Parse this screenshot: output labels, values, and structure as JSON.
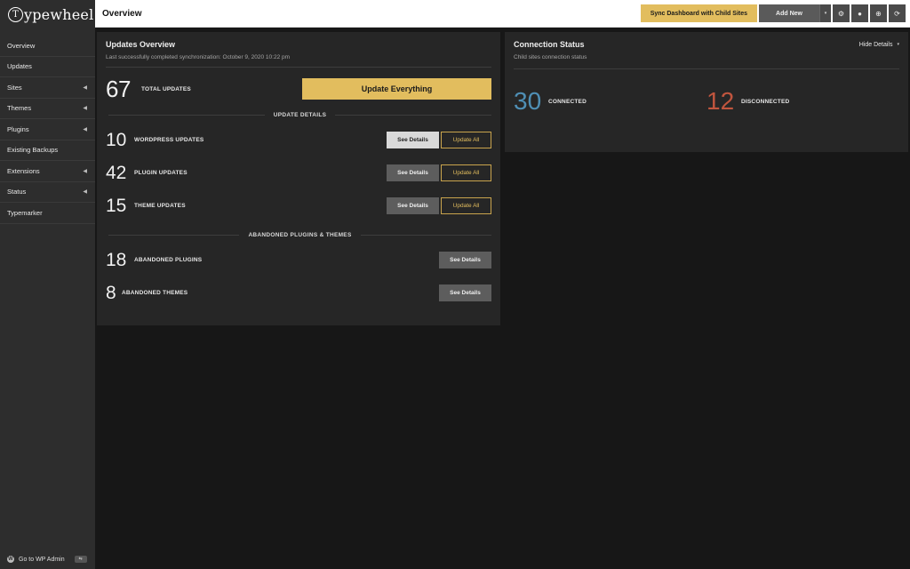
{
  "app": {
    "logo_text": "ypewheel",
    "logo_mark": "T"
  },
  "header": {
    "title": "Overview"
  },
  "toolbar": {
    "sync_label": "Sync Dashboard with Child Sites",
    "add_label": "Add New",
    "caret": "▾",
    "icons": [
      "gear-icon",
      "lightbulb-icon",
      "globe-icon",
      "refresh-icon"
    ]
  },
  "sidebar": {
    "items": [
      {
        "label": "Overview",
        "has_submenu": false
      },
      {
        "label": "Updates",
        "has_submenu": false
      },
      {
        "label": "Sites",
        "has_submenu": true
      },
      {
        "label": "Themes",
        "has_submenu": true
      },
      {
        "label": "Plugins",
        "has_submenu": true
      },
      {
        "label": "Existing Backups",
        "has_submenu": false
      },
      {
        "label": "Extensions",
        "has_submenu": true
      },
      {
        "label": "Status",
        "has_submenu": true
      },
      {
        "label": "Typemarker",
        "has_submenu": false
      }
    ],
    "caret": "◀",
    "wp_admin_label": "Go to WP Admin"
  },
  "updates": {
    "title": "Updates Overview",
    "subtitle": "Last successfully completed synchronization: October 9, 2020 10:22 pm",
    "total": {
      "count": "67",
      "label": "TOTAL UPDATES"
    },
    "update_everything_label": "Update Everything",
    "details_heading": "UPDATE DETAILS",
    "rows": [
      {
        "count": "10",
        "label": "WORDPRESS UPDATES",
        "details": "See Details",
        "update": "Update All"
      },
      {
        "count": "42",
        "label": "PLUGIN UPDATES",
        "details": "See Details",
        "update": "Update All"
      },
      {
        "count": "15",
        "label": "THEME UPDATES",
        "details": "See Details",
        "update": "Update All"
      }
    ],
    "abandoned_heading": "ABANDONED PLUGINS & THEMES",
    "abandoned": [
      {
        "count": "18",
        "label": "ABANDONED PLUGINS",
        "details": "See Details"
      },
      {
        "count": "8",
        "label": "ABANDONED THEMES",
        "details": "See Details"
      }
    ]
  },
  "connection": {
    "title": "Connection Status",
    "subtitle": "Child sites connection status",
    "hide_details_label": "Hide Details",
    "connected": {
      "count": "30",
      "label": "CONNECTED"
    },
    "disconnected": {
      "count": "12",
      "label": "DISCONNECTED"
    }
  },
  "colors": {
    "accent": "#e2bd5e",
    "connected": "#4f8fb5",
    "disconnected": "#c0553e"
  }
}
